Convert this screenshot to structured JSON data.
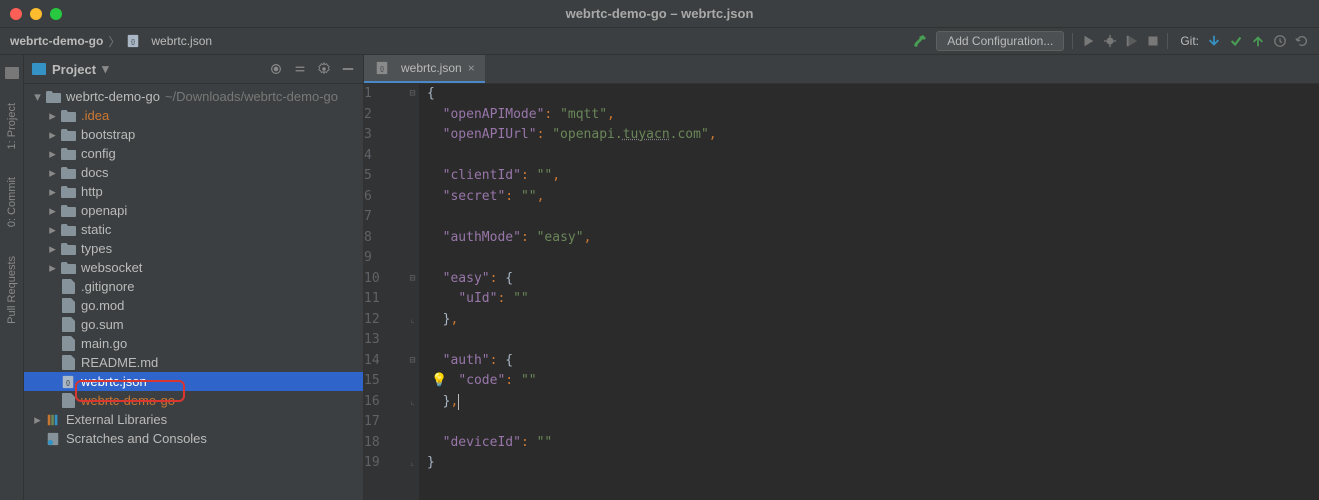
{
  "title": "webrtc-demo-go – webrtc.json",
  "breadcrumb": {
    "project": "webrtc-demo-go",
    "file": "webrtc.json"
  },
  "toolbar": {
    "addConfig": "Add Configuration...",
    "git": "Git:"
  },
  "sidebar_tabs": {
    "project": "1: Project",
    "commit": "0: Commit",
    "pull": "Pull Requests"
  },
  "projectPane": {
    "title": "Project",
    "root": {
      "name": "webrtc-demo-go",
      "path": "~/Downloads/webrtc-demo-go"
    },
    "folders": [
      ".idea",
      "bootstrap",
      "config",
      "docs",
      "http",
      "openapi",
      "static",
      "types",
      "websocket"
    ],
    "files": [
      ".gitignore",
      "go.mod",
      "go.sum",
      "main.go",
      "README.md",
      "webrtc.json",
      "webrtc-demo-go"
    ],
    "externals": "External Libraries",
    "scratches": "Scratches and Consoles"
  },
  "tab": {
    "name": "webrtc.json"
  },
  "code": {
    "lines": [
      [
        [
          "brace",
          "{"
        ]
      ],
      [
        [
          "indent",
          "  "
        ],
        [
          "key",
          "\"openAPIMode\""
        ],
        [
          "punct",
          ": "
        ],
        [
          "str",
          "\"mqtt\""
        ],
        [
          "punct",
          ","
        ]
      ],
      [
        [
          "indent",
          "  "
        ],
        [
          "key",
          "\"openAPIUrl\""
        ],
        [
          "punct",
          ": "
        ],
        [
          "stru",
          "\"openapi.tuyacn.com\""
        ],
        [
          "punct",
          ","
        ]
      ],
      [],
      [
        [
          "indent",
          "  "
        ],
        [
          "key",
          "\"clientId\""
        ],
        [
          "punct",
          ": "
        ],
        [
          "str",
          "\"\""
        ],
        [
          "punct",
          ","
        ]
      ],
      [
        [
          "indent",
          "  "
        ],
        [
          "key",
          "\"secret\""
        ],
        [
          "punct",
          ": "
        ],
        [
          "str",
          "\"\""
        ],
        [
          "punct",
          ","
        ]
      ],
      [],
      [
        [
          "indent",
          "  "
        ],
        [
          "key",
          "\"authMode\""
        ],
        [
          "punct",
          ": "
        ],
        [
          "str",
          "\"easy\""
        ],
        [
          "punct",
          ","
        ]
      ],
      [],
      [
        [
          "indent",
          "  "
        ],
        [
          "key",
          "\"easy\""
        ],
        [
          "punct",
          ": "
        ],
        [
          "brace",
          "{"
        ]
      ],
      [
        [
          "indent",
          "    "
        ],
        [
          "key",
          "\"uId\""
        ],
        [
          "punct",
          ": "
        ],
        [
          "str",
          "\"\""
        ]
      ],
      [
        [
          "indent",
          "  "
        ],
        [
          "brace",
          "}"
        ],
        [
          "punct",
          ","
        ]
      ],
      [],
      [
        [
          "indent",
          "  "
        ],
        [
          "key",
          "\"auth\""
        ],
        [
          "punct",
          ": "
        ],
        [
          "brace",
          "{"
        ]
      ],
      [
        [
          "indent",
          "    "
        ],
        [
          "key",
          "\"code\""
        ],
        [
          "punct",
          ": "
        ],
        [
          "str",
          "\"\""
        ]
      ],
      [
        [
          "indent",
          "  "
        ],
        [
          "brace",
          "}"
        ],
        [
          "punct",
          ","
        ],
        [
          "caret",
          ""
        ]
      ],
      [],
      [
        [
          "indent",
          "  "
        ],
        [
          "key",
          "\"deviceId\""
        ],
        [
          "punct",
          ": "
        ],
        [
          "str",
          "\"\""
        ]
      ],
      [
        [
          "brace",
          "}"
        ]
      ]
    ],
    "foldMarks": {
      "1": "d",
      "2": "b",
      "3": "b",
      "5": "b",
      "6": "b",
      "8": "b",
      "10": "d",
      "12": "u",
      "14": "d",
      "16": "u",
      "18": "b",
      "19": "u"
    },
    "bulbLine": 15
  }
}
